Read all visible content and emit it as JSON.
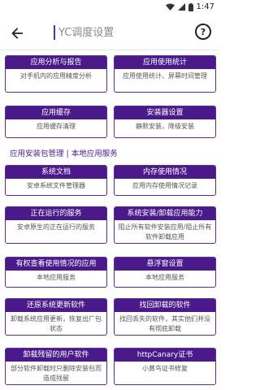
{
  "status_bar": {
    "time": "1:47"
  },
  "header": {
    "search_placeholder": "YC调度设置"
  },
  "section_title": "应用安装包管理 | 本地应用服务",
  "cards_top": [
    {
      "title": "应用分析与报告",
      "desc": "对手机内的应用精度分析"
    },
    {
      "title": "应用使用统计",
      "desc": "应用使用统计、屏幕时间管理"
    },
    {
      "title": "应用缓存",
      "desc": "应用缓存清理"
    },
    {
      "title": "安装器设置",
      "desc": "静默安装，降级安装"
    }
  ],
  "cards_bottom": [
    {
      "title": "系统文档",
      "desc": "安卓系统文件管理器"
    },
    {
      "title": "内存使用情况",
      "desc": "应用内存使用情况记录"
    },
    {
      "title": "正在运行的服务",
      "desc": "安卓原生的正在运行的服务"
    },
    {
      "title": "系统安装/卸载应用能力",
      "desc": "阻止所有软件安装应用/阻止所有软件卸载应用"
    },
    {
      "title": "有权查看使用情况的应用",
      "desc": "本地应用服务"
    },
    {
      "title": "悬浮窗设置",
      "desc": "本地应用服务"
    },
    {
      "title": "还原系统更新软件",
      "desc": "卸载系统应用更新，恢复出厂包状态"
    },
    {
      "title": "找回卸载的软件",
      "desc": "找回丢失的软件，其实他们并没有彻底卸载"
    },
    {
      "title": "卸载残留的用户软件",
      "desc": "部分软件卸载时只删除安装包而造成残留"
    },
    {
      "title": "httpCanary证书",
      "desc": "小黄鸟证书修复"
    }
  ]
}
